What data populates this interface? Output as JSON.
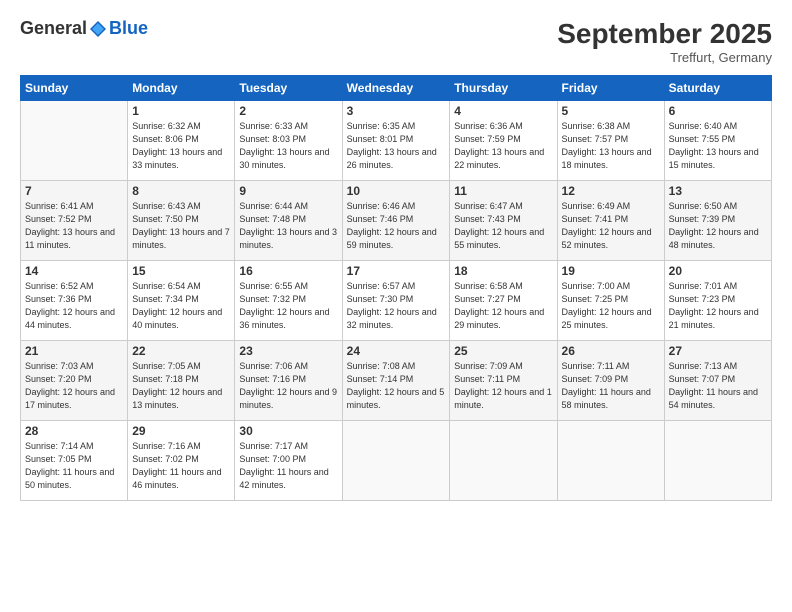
{
  "header": {
    "logo_general": "General",
    "logo_blue": "Blue",
    "month": "September 2025",
    "location": "Treffurt, Germany"
  },
  "days_of_week": [
    "Sunday",
    "Monday",
    "Tuesday",
    "Wednesday",
    "Thursday",
    "Friday",
    "Saturday"
  ],
  "weeks": [
    [
      {
        "day": "",
        "sunrise": "",
        "sunset": "",
        "daylight": ""
      },
      {
        "day": "1",
        "sunrise": "Sunrise: 6:32 AM",
        "sunset": "Sunset: 8:06 PM",
        "daylight": "Daylight: 13 hours and 33 minutes."
      },
      {
        "day": "2",
        "sunrise": "Sunrise: 6:33 AM",
        "sunset": "Sunset: 8:03 PM",
        "daylight": "Daylight: 13 hours and 30 minutes."
      },
      {
        "day": "3",
        "sunrise": "Sunrise: 6:35 AM",
        "sunset": "Sunset: 8:01 PM",
        "daylight": "Daylight: 13 hours and 26 minutes."
      },
      {
        "day": "4",
        "sunrise": "Sunrise: 6:36 AM",
        "sunset": "Sunset: 7:59 PM",
        "daylight": "Daylight: 13 hours and 22 minutes."
      },
      {
        "day": "5",
        "sunrise": "Sunrise: 6:38 AM",
        "sunset": "Sunset: 7:57 PM",
        "daylight": "Daylight: 13 hours and 18 minutes."
      },
      {
        "day": "6",
        "sunrise": "Sunrise: 6:40 AM",
        "sunset": "Sunset: 7:55 PM",
        "daylight": "Daylight: 13 hours and 15 minutes."
      }
    ],
    [
      {
        "day": "7",
        "sunrise": "Sunrise: 6:41 AM",
        "sunset": "Sunset: 7:52 PM",
        "daylight": "Daylight: 13 hours and 11 minutes."
      },
      {
        "day": "8",
        "sunrise": "Sunrise: 6:43 AM",
        "sunset": "Sunset: 7:50 PM",
        "daylight": "Daylight: 13 hours and 7 minutes."
      },
      {
        "day": "9",
        "sunrise": "Sunrise: 6:44 AM",
        "sunset": "Sunset: 7:48 PM",
        "daylight": "Daylight: 13 hours and 3 minutes."
      },
      {
        "day": "10",
        "sunrise": "Sunrise: 6:46 AM",
        "sunset": "Sunset: 7:46 PM",
        "daylight": "Daylight: 12 hours and 59 minutes."
      },
      {
        "day": "11",
        "sunrise": "Sunrise: 6:47 AM",
        "sunset": "Sunset: 7:43 PM",
        "daylight": "Daylight: 12 hours and 55 minutes."
      },
      {
        "day": "12",
        "sunrise": "Sunrise: 6:49 AM",
        "sunset": "Sunset: 7:41 PM",
        "daylight": "Daylight: 12 hours and 52 minutes."
      },
      {
        "day": "13",
        "sunrise": "Sunrise: 6:50 AM",
        "sunset": "Sunset: 7:39 PM",
        "daylight": "Daylight: 12 hours and 48 minutes."
      }
    ],
    [
      {
        "day": "14",
        "sunrise": "Sunrise: 6:52 AM",
        "sunset": "Sunset: 7:36 PM",
        "daylight": "Daylight: 12 hours and 44 minutes."
      },
      {
        "day": "15",
        "sunrise": "Sunrise: 6:54 AM",
        "sunset": "Sunset: 7:34 PM",
        "daylight": "Daylight: 12 hours and 40 minutes."
      },
      {
        "day": "16",
        "sunrise": "Sunrise: 6:55 AM",
        "sunset": "Sunset: 7:32 PM",
        "daylight": "Daylight: 12 hours and 36 minutes."
      },
      {
        "day": "17",
        "sunrise": "Sunrise: 6:57 AM",
        "sunset": "Sunset: 7:30 PM",
        "daylight": "Daylight: 12 hours and 32 minutes."
      },
      {
        "day": "18",
        "sunrise": "Sunrise: 6:58 AM",
        "sunset": "Sunset: 7:27 PM",
        "daylight": "Daylight: 12 hours and 29 minutes."
      },
      {
        "day": "19",
        "sunrise": "Sunrise: 7:00 AM",
        "sunset": "Sunset: 7:25 PM",
        "daylight": "Daylight: 12 hours and 25 minutes."
      },
      {
        "day": "20",
        "sunrise": "Sunrise: 7:01 AM",
        "sunset": "Sunset: 7:23 PM",
        "daylight": "Daylight: 12 hours and 21 minutes."
      }
    ],
    [
      {
        "day": "21",
        "sunrise": "Sunrise: 7:03 AM",
        "sunset": "Sunset: 7:20 PM",
        "daylight": "Daylight: 12 hours and 17 minutes."
      },
      {
        "day": "22",
        "sunrise": "Sunrise: 7:05 AM",
        "sunset": "Sunset: 7:18 PM",
        "daylight": "Daylight: 12 hours and 13 minutes."
      },
      {
        "day": "23",
        "sunrise": "Sunrise: 7:06 AM",
        "sunset": "Sunset: 7:16 PM",
        "daylight": "Daylight: 12 hours and 9 minutes."
      },
      {
        "day": "24",
        "sunrise": "Sunrise: 7:08 AM",
        "sunset": "Sunset: 7:14 PM",
        "daylight": "Daylight: 12 hours and 5 minutes."
      },
      {
        "day": "25",
        "sunrise": "Sunrise: 7:09 AM",
        "sunset": "Sunset: 7:11 PM",
        "daylight": "Daylight: 12 hours and 1 minute."
      },
      {
        "day": "26",
        "sunrise": "Sunrise: 7:11 AM",
        "sunset": "Sunset: 7:09 PM",
        "daylight": "Daylight: 11 hours and 58 minutes."
      },
      {
        "day": "27",
        "sunrise": "Sunrise: 7:13 AM",
        "sunset": "Sunset: 7:07 PM",
        "daylight": "Daylight: 11 hours and 54 minutes."
      }
    ],
    [
      {
        "day": "28",
        "sunrise": "Sunrise: 7:14 AM",
        "sunset": "Sunset: 7:05 PM",
        "daylight": "Daylight: 11 hours and 50 minutes."
      },
      {
        "day": "29",
        "sunrise": "Sunrise: 7:16 AM",
        "sunset": "Sunset: 7:02 PM",
        "daylight": "Daylight: 11 hours and 46 minutes."
      },
      {
        "day": "30",
        "sunrise": "Sunrise: 7:17 AM",
        "sunset": "Sunset: 7:00 PM",
        "daylight": "Daylight: 11 hours and 42 minutes."
      },
      {
        "day": "",
        "sunrise": "",
        "sunset": "",
        "daylight": ""
      },
      {
        "day": "",
        "sunrise": "",
        "sunset": "",
        "daylight": ""
      },
      {
        "day": "",
        "sunrise": "",
        "sunset": "",
        "daylight": ""
      },
      {
        "day": "",
        "sunrise": "",
        "sunset": "",
        "daylight": ""
      }
    ]
  ]
}
